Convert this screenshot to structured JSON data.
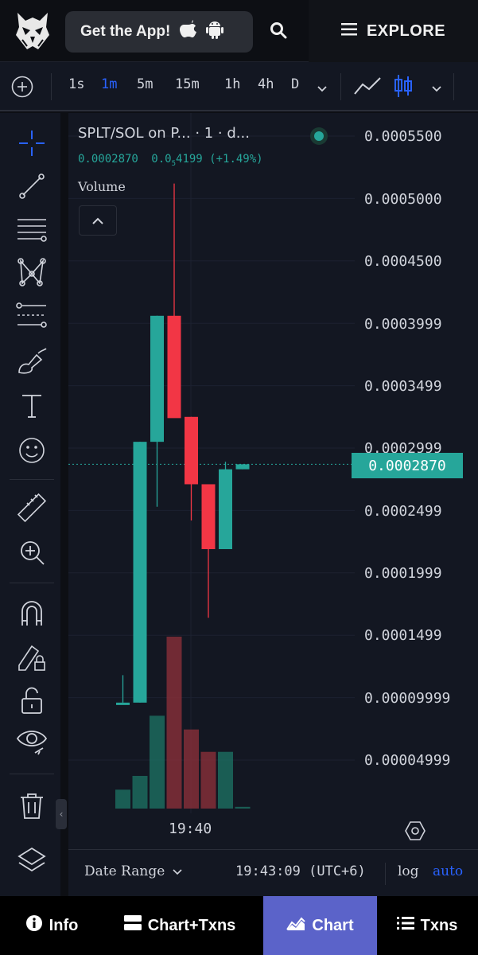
{
  "header": {
    "get_app_label": "Get the App!",
    "explore_label": "EXPLORE"
  },
  "toolbar": {
    "timeframes": [
      "1s",
      "1m",
      "5m",
      "15m",
      "1h",
      "4h",
      "D"
    ],
    "active_timeframe": "1m"
  },
  "legend": {
    "title": "SPLT/SOL on P... · 1 · d...",
    "price": "0.0002870",
    "change_prefix": "0.0",
    "change_sub": "5",
    "change_rest": "4199 (+1.49%)",
    "volume_label": "Volume"
  },
  "price_axis": {
    "ticks": [
      "0.0005500",
      "0.0005000",
      "0.0004500",
      "0.0003999",
      "0.0003499",
      "0.0002999",
      "0.0002499",
      "0.0001999",
      "0.0001499",
      "0.00009999",
      "0.00004999"
    ],
    "current_price": "0.0002870"
  },
  "time_axis": {
    "tick": "19:40"
  },
  "footer": {
    "date_range_label": "Date Range",
    "clock": "19:43:09 (UTC+6)",
    "log_label": "log",
    "auto_label": "auto"
  },
  "bottom_nav": {
    "items": [
      "Info",
      "Chart+Txns",
      "Chart",
      "Txns"
    ],
    "active": "Chart"
  },
  "colors": {
    "up": "#26a69a",
    "down": "#f23645",
    "accent": "#2962ff",
    "nav_active": "#5b63c9"
  },
  "chart_data": {
    "type": "candlestick",
    "y_range": [
      0.0,
      0.00055
    ],
    "candles": [
      {
        "open": 9.6e-05,
        "high": 0.000118,
        "low": 9.6e-05,
        "close": 9.6e-05,
        "volume": 0.11
      },
      {
        "open": 9.6e-05,
        "high": 0.000305,
        "low": 9.6e-05,
        "close": 0.000305,
        "volume": 0.19
      },
      {
        "open": 0.000305,
        "high": 0.000406,
        "low": 0.000253,
        "close": 0.000406,
        "volume": 0.54
      },
      {
        "open": 0.000406,
        "high": 0.000512,
        "low": 0.000375,
        "close": 0.000324,
        "volume": 1.0
      },
      {
        "open": 0.000325,
        "high": 0.000325,
        "low": 0.000242,
        "close": 0.000271,
        "volume": 0.46
      },
      {
        "open": 0.000271,
        "high": 0.000271,
        "low": 0.000164,
        "close": 0.000219,
        "volume": 0.33
      },
      {
        "open": 0.000219,
        "high": 0.000289,
        "low": 0.000219,
        "close": 0.000283,
        "volume": 0.33
      },
      {
        "open": 0.000283,
        "high": 0.000287,
        "low": 0.000283,
        "close": 0.000287,
        "volume": 0.01
      }
    ]
  }
}
